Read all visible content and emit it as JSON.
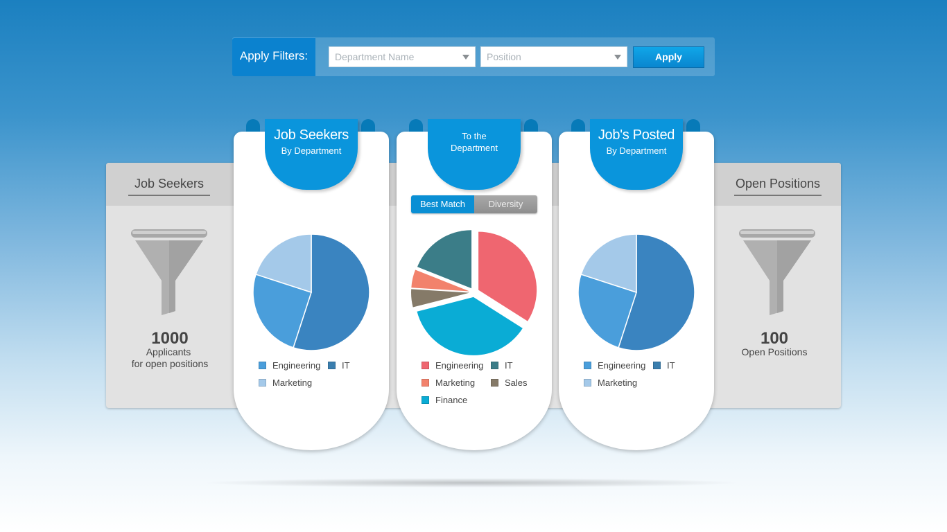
{
  "filters": {
    "label": "Apply Filters:",
    "department_placeholder": "Department Name",
    "position_placeholder": "Position",
    "apply_label": "Apply"
  },
  "left_panel": {
    "title": "Job Seekers",
    "count": "1000",
    "line1": "Applicants",
    "line2": "for open positions"
  },
  "right_panel": {
    "title": "Open Positions",
    "count": "100",
    "line1": "Open Positions"
  },
  "cards": [
    {
      "title": "Job Seekers",
      "subtitle": "By Department",
      "legend": [
        "Engineering",
        "IT",
        "Marketing"
      ]
    },
    {
      "title_line1": "To the",
      "title_line2": "Department",
      "toggle": [
        "Best Match",
        "Diversity"
      ],
      "legend": [
        "Engineering",
        "IT",
        "Marketing",
        "Sales",
        "Finance"
      ]
    },
    {
      "title": "Job's Posted",
      "subtitle": "By Department",
      "legend": [
        "Engineering",
        "IT",
        "Marketing"
      ]
    }
  ],
  "chart_data": [
    {
      "type": "pie",
      "categories": [
        "IT",
        "Engineering",
        "Marketing"
      ],
      "values": [
        55,
        25,
        20
      ],
      "colors": [
        "#3a84c0",
        "#4a9edb",
        "#a4c9e9"
      ]
    },
    {
      "type": "pie",
      "categories": [
        "Engineering",
        "Finance",
        "Sales",
        "Marketing",
        "IT"
      ],
      "values": [
        34,
        37,
        5,
        5,
        19
      ],
      "colors": [
        "#ef6670",
        "#0aacd5",
        "#857a68",
        "#f2826c",
        "#3b7d88"
      ]
    },
    {
      "type": "pie",
      "categories": [
        "IT",
        "Engineering",
        "Marketing"
      ],
      "values": [
        55,
        25,
        20
      ],
      "colors": [
        "#3a84c0",
        "#4a9edb",
        "#a4c9e9"
      ]
    }
  ],
  "legend_colors": {
    "Engineering_blue": "#4a9edb",
    "IT_blue": "#3a7eae",
    "Marketing_blue": "#a4c9e9",
    "Engineering_red": "#ef6670",
    "IT_teal": "#3b7d88",
    "Marketing_orange": "#f2826c",
    "Sales_brown": "#857a68",
    "Finance_cyan": "#0aacd5"
  }
}
